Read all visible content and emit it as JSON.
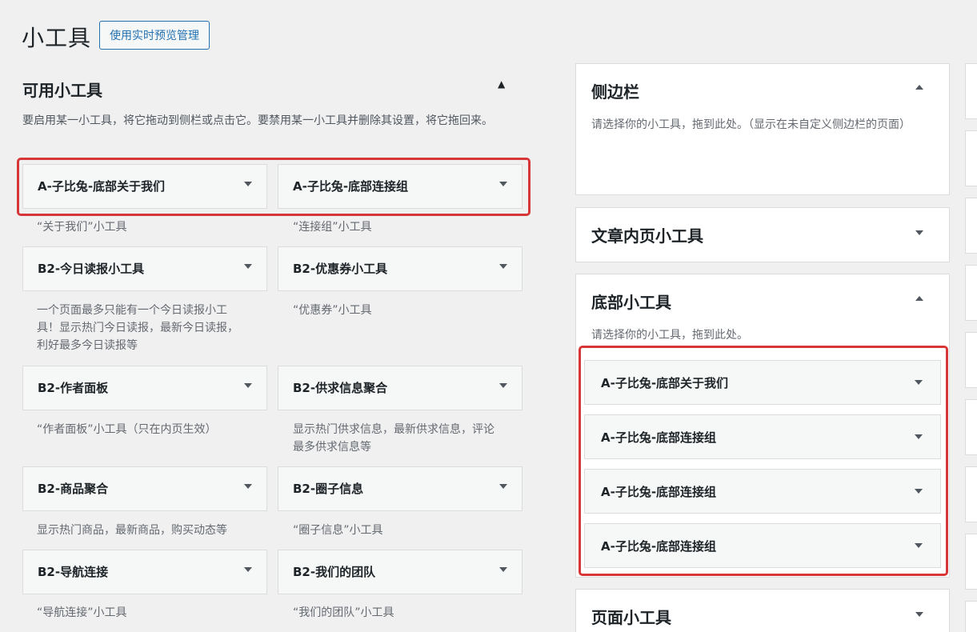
{
  "header": {
    "title": "小工具",
    "preview_button": "使用实时预览管理"
  },
  "available": {
    "title": "可用小工具",
    "toggle": "▲",
    "description": "要启用某一小工具，将它拖动到侧栏或点击它。要禁用某一小工具并删除其设置，将它拖回来。",
    "widgets": [
      {
        "title": "A-子比兔-底部关于我们",
        "desc": "“关于我们”小工具"
      },
      {
        "title": "A-子比兔-底部连接组",
        "desc": "“连接组”小工具"
      },
      {
        "title": "B2-今日读报小工具",
        "desc": "一个页面最多只能有一个今日读报小工具！显示热门今日读报，最新今日读报，利好最多今日读报等"
      },
      {
        "title": "B2-优惠券小工具",
        "desc": "“优惠券”小工具"
      },
      {
        "title": "B2-作者面板",
        "desc": "“作者面板”小工具（只在内页生效）"
      },
      {
        "title": "B2-供求信息聚合",
        "desc": "显示热门供求信息，最新供求信息，评论最多供求信息等"
      },
      {
        "title": "B2-商品聚合",
        "desc": "显示热门商品，最新商品，购买动态等"
      },
      {
        "title": "B2-圈子信息",
        "desc": "“圈子信息”小工具"
      },
      {
        "title": "B2-导航连接",
        "desc": "“导航连接”小工具"
      },
      {
        "title": "B2-我们的团队",
        "desc": "“我们的团队”小工具"
      }
    ]
  },
  "sidebars": [
    {
      "title": "侧边栏",
      "desc": "请选择你的小工具，拖到此处。（显示在未自定义侧边栏的页面）",
      "expanded": true
    },
    {
      "title": "文章内页小工具",
      "expanded": false
    },
    {
      "title": "底部小工具",
      "desc": "请选择你的小工具，拖到此处。",
      "expanded": true,
      "widgets": [
        "A-子比兔-底部关于我们",
        "A-子比兔-底部连接组",
        "A-子比兔-底部连接组",
        "A-子比兔-底部连接组"
      ]
    },
    {
      "title": "页面小工具",
      "expanded": false
    }
  ],
  "colors": {
    "highlight": "#d63638",
    "accent": "#2271b1",
    "background": "#f0f0f1"
  }
}
